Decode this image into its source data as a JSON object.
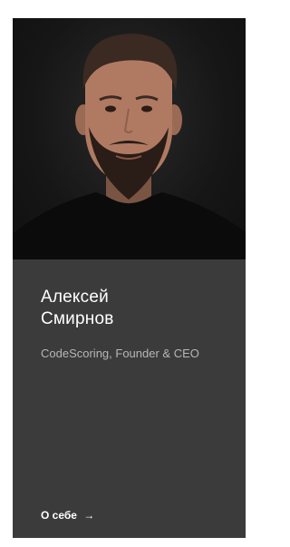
{
  "person": {
    "first_name": "Алексей",
    "last_name": "Смирнов",
    "role": "CodeScoring, Founder & CEO",
    "photo_icon": "person-portrait"
  },
  "actions": {
    "about_label": "О себе",
    "about_arrow": "→"
  },
  "colors": {
    "card_background": "#3b3b3b",
    "photo_background": "#151515",
    "name_text": "#ffffff",
    "role_text": "#b6b6b6"
  }
}
